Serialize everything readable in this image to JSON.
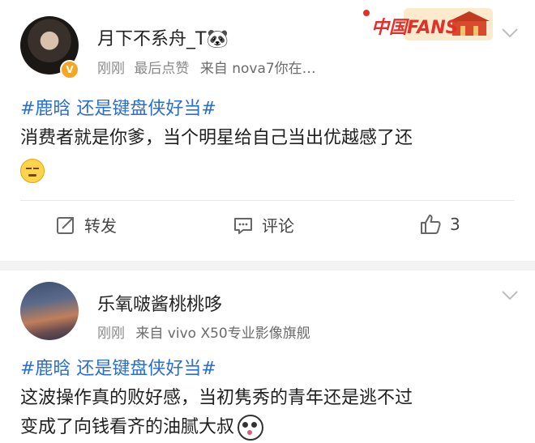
{
  "posts": [
    {
      "username": "月下不系舟_T🐼",
      "meta_time": "刚刚",
      "meta_extra": "最后点赞",
      "meta_source": "来自 nova7你在…",
      "tag": "#鹿晗 还是键盘侠好当#",
      "text": "消费者就是你爹，当个明星给自己当出优越感了还",
      "emoji": "smirk-emoji",
      "actions": {
        "repost": "转发",
        "comment": "评论",
        "like_count": "3"
      },
      "badge": "V"
    },
    {
      "username": "乐氧啵酱桃桃哆",
      "meta_time": "刚刚",
      "meta_source": "来自 vivo X50专业影像旗舰",
      "tag": "#鹿晗 还是键盘侠好当#",
      "text_line1": "这波操作真的败好感，当初隽秀的青年还是逃不过",
      "text_line2": "变成了向钱看齐的油腻大叔",
      "emoji": "panda-emoji"
    }
  ],
  "fans_badge": {
    "label": "中国FANS"
  },
  "colors": {
    "accent": "#2a6fd0",
    "badge": "#f5a623"
  }
}
